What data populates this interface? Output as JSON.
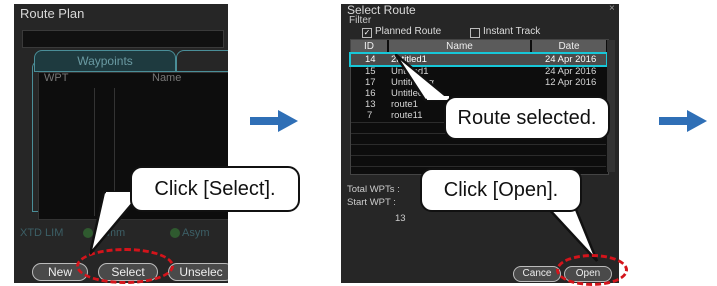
{
  "panel1": {
    "title": "Route Plan",
    "tab_waypoints": "Waypoints",
    "col_wpt": "WPT",
    "col_name": "Name",
    "xtd_label": "XTD LIM",
    "symmetrical_label": "Symm",
    "symmetrical_label_tail": "l",
    "asymmetrical_label": "Asym",
    "btn_new": "New",
    "btn_select": "Select",
    "btn_unselect": "Unselec"
  },
  "panel2": {
    "title": "Select Route",
    "close_icon": "×",
    "filter_label": "Filter",
    "cb_planned": "Planned Route",
    "cb_instant": "Instant Track",
    "col_id": "ID",
    "col_name": "Name",
    "col_date": "Date",
    "rows": [
      {
        "id": "14",
        "name": "2ntitled1",
        "date": "24 Apr 2016",
        "selected": true
      },
      {
        "id": "15",
        "name": "Untitled1",
        "date": "24 Apr 2016"
      },
      {
        "id": "17",
        "name": "Untitled1α",
        "date": "12 Apr 2016"
      },
      {
        "id": "16",
        "name": "Untitled2",
        "date": ""
      },
      {
        "id": "13",
        "name": "route1",
        "date": ""
      },
      {
        "id": "7",
        "name": "route11",
        "date": ""
      }
    ],
    "total_wpts": "Total WPTs :",
    "start_wpt": "Start WPT :",
    "start_num": "13",
    "btn_cancel": "Cance",
    "btn_open": "Open"
  },
  "callouts": {
    "click_select": "Click [Select].",
    "route_selected": "Route selected.",
    "click_open": "Click [Open]."
  },
  "colors": {
    "arrow": "#2f6fb6",
    "highlight_ring": "#d4141b",
    "selection_outline": "#17c7d8"
  }
}
